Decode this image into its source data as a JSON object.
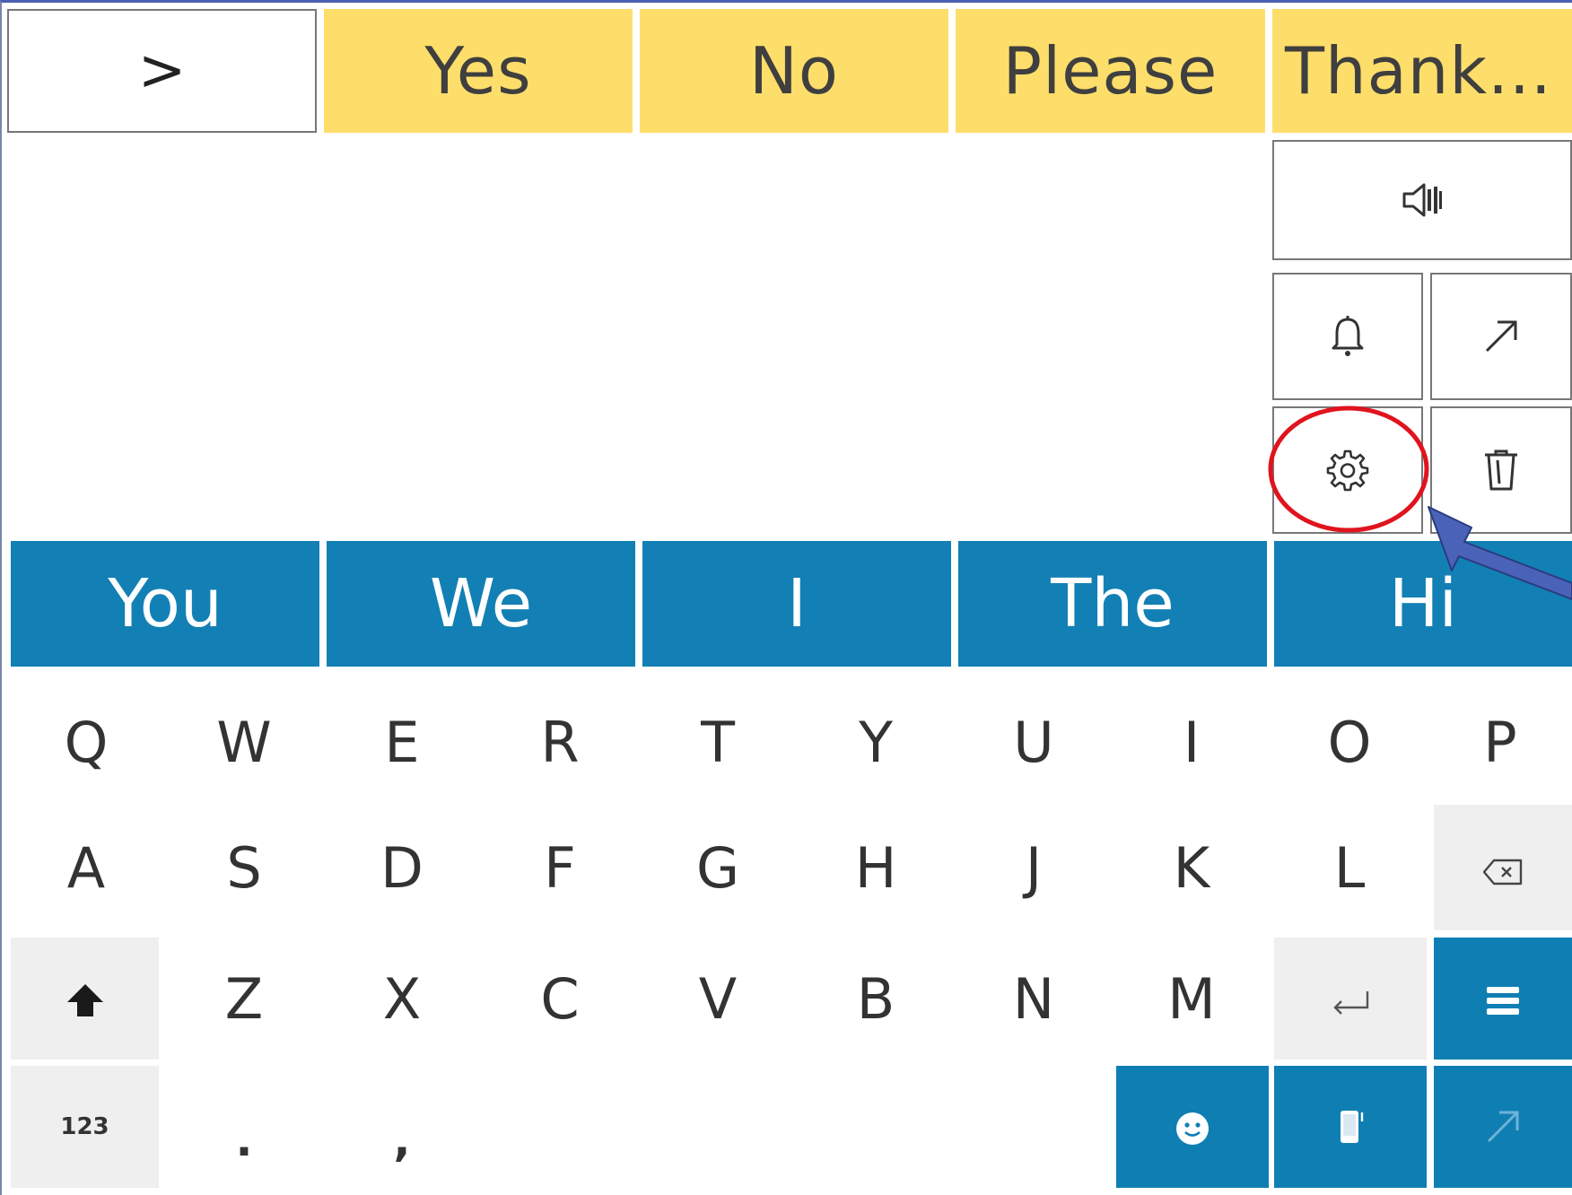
{
  "topbar": {
    "nav_label": ">",
    "phrases": [
      "Yes",
      "No",
      "Please",
      "Thank..."
    ]
  },
  "actions": {
    "speak": "speaker-icon",
    "alert": "bell-icon",
    "expand": "arrow-up-right-icon",
    "settings": "gear-icon",
    "delete": "trash-icon"
  },
  "predictions": [
    "You",
    "We",
    "I",
    "The",
    "Hi"
  ],
  "keyboard": {
    "row1": [
      "Q",
      "W",
      "E",
      "R",
      "T",
      "Y",
      "U",
      "I",
      "O",
      "P"
    ],
    "row2": [
      "A",
      "S",
      "D",
      "F",
      "G",
      "H",
      "J",
      "K",
      "L"
    ],
    "row3": [
      "Z",
      "X",
      "C",
      "V",
      "B",
      "N",
      "M"
    ],
    "numbers_label": "123",
    "period": ".",
    "comma": ","
  },
  "colors": {
    "phrase_bg": "#fede6a",
    "prediction_bg": "#1280b4",
    "key_blue": "#0f7fb3",
    "annotation_circle": "#e0141e",
    "annotation_arrow": "#4a62b8"
  }
}
